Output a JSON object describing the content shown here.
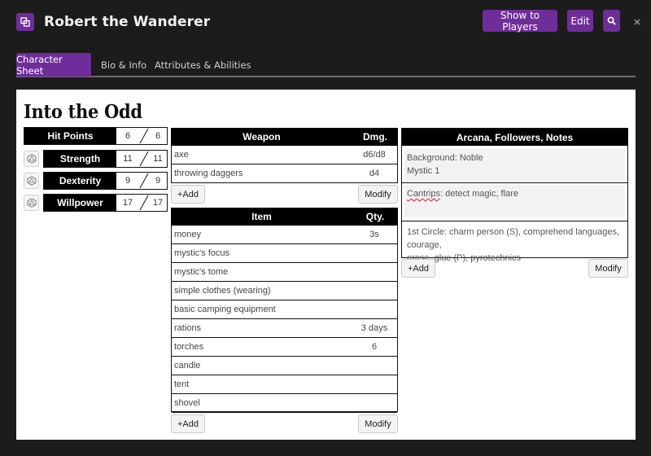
{
  "window": {
    "title": "Robert the Wanderer",
    "show_players_label": "Show to Players",
    "edit_label": "Edit",
    "close_glyph": "×",
    "accent": "#6f2d9a"
  },
  "tabs": [
    {
      "label": "Character Sheet",
      "active": true
    },
    {
      "label": "Bio & Info",
      "active": false
    },
    {
      "label": "Attributes & Abilities",
      "active": false
    }
  ],
  "sheet": {
    "title": "Into the Odd",
    "hit_points": {
      "label": "Hit Points",
      "current": "6",
      "max": "6"
    },
    "abilities": [
      {
        "label": "Strength",
        "current": "11",
        "max": "11"
      },
      {
        "label": "Dexterity",
        "current": "9",
        "max": "9"
      },
      {
        "label": "Willpower",
        "current": "17",
        "max": "17"
      }
    ],
    "weapons": {
      "header_name": "Weapon",
      "header_value": "Dmg.",
      "rows": [
        {
          "name": "axe",
          "value": "d6/d8"
        },
        {
          "name": "throwing daggers",
          "value": "d4"
        }
      ],
      "add_label": "+Add",
      "modify_label": "Modify"
    },
    "items": {
      "header_name": "Item",
      "header_value": "Qty.",
      "rows": [
        {
          "name": "money",
          "value": "3s"
        },
        {
          "name": "mystic's focus",
          "value": ""
        },
        {
          "name": "mystic's tome",
          "value": ""
        },
        {
          "name": "simple clothes (wearing)",
          "value": ""
        },
        {
          "name": "basic camping equipment",
          "value": ""
        },
        {
          "name": "rations",
          "value": "3 days"
        },
        {
          "name": "torches",
          "value": "6"
        },
        {
          "name": "candle",
          "value": ""
        },
        {
          "name": "tent",
          "value": ""
        },
        {
          "name": "shovel",
          "value": ""
        }
      ],
      "add_label": "+Add",
      "modify_label": "Modify"
    },
    "notes": {
      "header": "Arcana, Followers, Notes",
      "background_line1": "Background: Noble",
      "background_line2": "Mystic 1",
      "cantrips_word": "Cantrips",
      "cantrips_rest": ": detect magic, flare",
      "first_circle_line1": "1st Circle: charm person (S), comprehend languages, courage,",
      "first_circle_line2": "erase, glue (P), pyrotechnics",
      "add_label": "+Add",
      "modify_label": "Modify"
    }
  }
}
